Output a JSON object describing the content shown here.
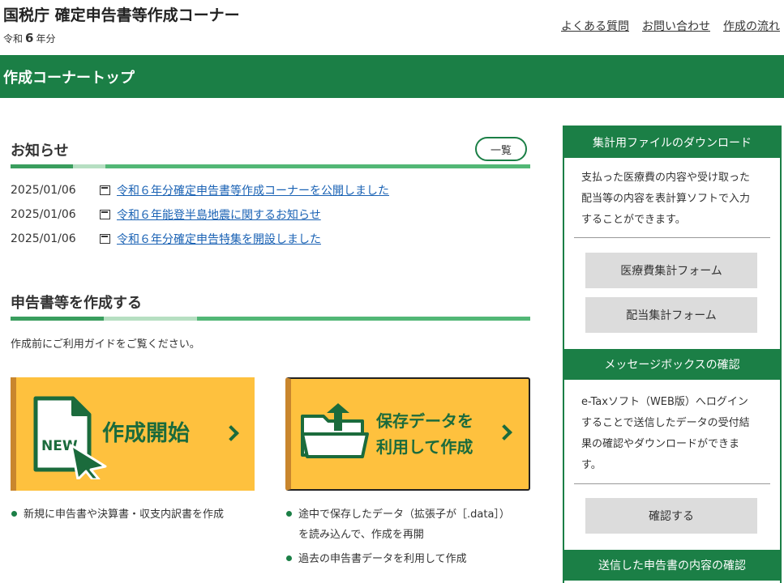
{
  "header": {
    "title": "国税庁 確定申告書等作成コーナー",
    "year_prefix": "令和",
    "year_num": "6",
    "year_suffix": "年分",
    "links": [
      "よくある質問",
      "お問い合わせ",
      "作成の流れ"
    ]
  },
  "banner": {
    "title": "作成コーナートップ"
  },
  "news": {
    "heading": "お知らせ",
    "list_button": "一覧",
    "items": [
      {
        "date": "2025/01/06",
        "text": "令和６年分確定申告書等作成コーナーを公開しました"
      },
      {
        "date": "2025/01/06",
        "text": "令和６年能登半島地震に関するお知らせ"
      },
      {
        "date": "2025/01/06",
        "text": "令和６年分確定申告特集を開設しました"
      }
    ]
  },
  "create": {
    "heading": "申告書等を作成する",
    "guide": "作成前にご利用ガイドをご覧ください。",
    "new_card": {
      "badge": "NEW",
      "label": "作成開始"
    },
    "saved_card": {
      "line1": "保存データを",
      "line2": "利用して作成"
    },
    "new_bullets": [
      "新規に申告書や決算書・収支内訳書を作成"
    ],
    "saved_bullets": [
      {
        "line1": "途中で保存したデータ（拡張子が［.data］）",
        "line2": "を読み込んで、作成を再開"
      },
      {
        "line1": "過去の申告書データを利用して作成"
      }
    ]
  },
  "sidebar": {
    "download": {
      "heading": "集計用ファイルのダウンロード",
      "text_lines": [
        "支払った医療費の内容や受け取った",
        "配当等の内容を表計算ソフトで入力",
        "することができます。"
      ],
      "buttons": [
        "医療費集計フォーム",
        "配当集計フォーム"
      ]
    },
    "message_box": {
      "heading": "メッセージボックスの確認",
      "text_lines": [
        "e-Taxソフト（WEB版）へログイン",
        "することで送信したデータの受付結",
        "果の確認やダウンロードができま",
        "す。"
      ],
      "button": "確認する"
    },
    "sent": {
      "heading": "送信した申告書の内容の確認"
    }
  },
  "colors": {
    "brand_green": "#1b7f46",
    "card_yellow": "#fec13e",
    "link_blue": "#1a62b4"
  }
}
